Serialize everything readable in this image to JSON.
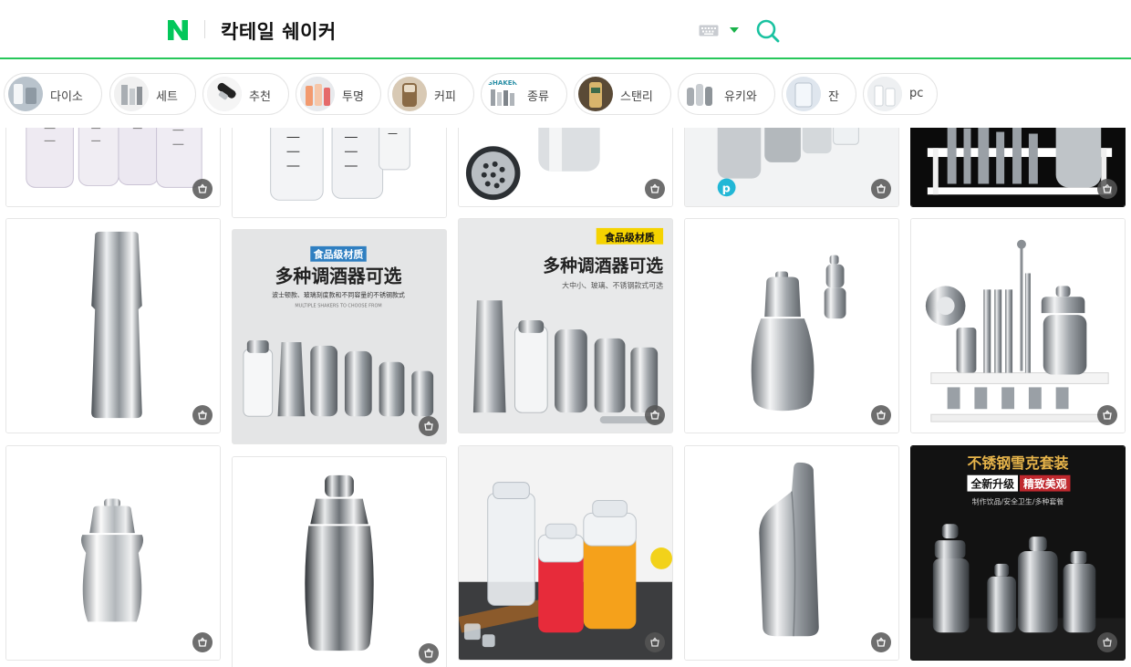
{
  "header": {
    "logo_letter": "N",
    "query": "칵테일 쉐이커",
    "colors": {
      "brand": "#03c75a",
      "accent_line": "#27c75a"
    }
  },
  "chips": [
    {
      "label": "다이소"
    },
    {
      "label": "세트"
    },
    {
      "label": "추천"
    },
    {
      "label": "투명"
    },
    {
      "label": "커피"
    },
    {
      "label": "종류",
      "thumb_text": "SHAKER"
    },
    {
      "label": "스탠리"
    },
    {
      "label": "유키와"
    },
    {
      "label": "잔"
    },
    {
      "label": "pc"
    }
  ],
  "ads": {
    "ad1_badge": "食品级材质",
    "ad1_title": "多种调酒器可选",
    "ad1_sub": "波士顿款、玻璃刻度款和不同容量的不锈钢款式",
    "ad1_small": "MULTIPLE SHAKERS TO CHOOSE FROM",
    "ad2_badge": "食品级材质",
    "ad2_title": "多种调酒器可选",
    "ad2_sub": "大中小、玻璃、不锈钢款式可选",
    "ad3_title": "不锈钢雪克套装",
    "ad3_tag1": "全新升级",
    "ad3_tag2": "精致美观",
    "ad3_sub": "制作饮品/安全卫生/多种套餐"
  },
  "icons": {
    "cart": "shopping-basket-icon",
    "search": "search-icon",
    "keyboard": "keyboard-icon"
  }
}
